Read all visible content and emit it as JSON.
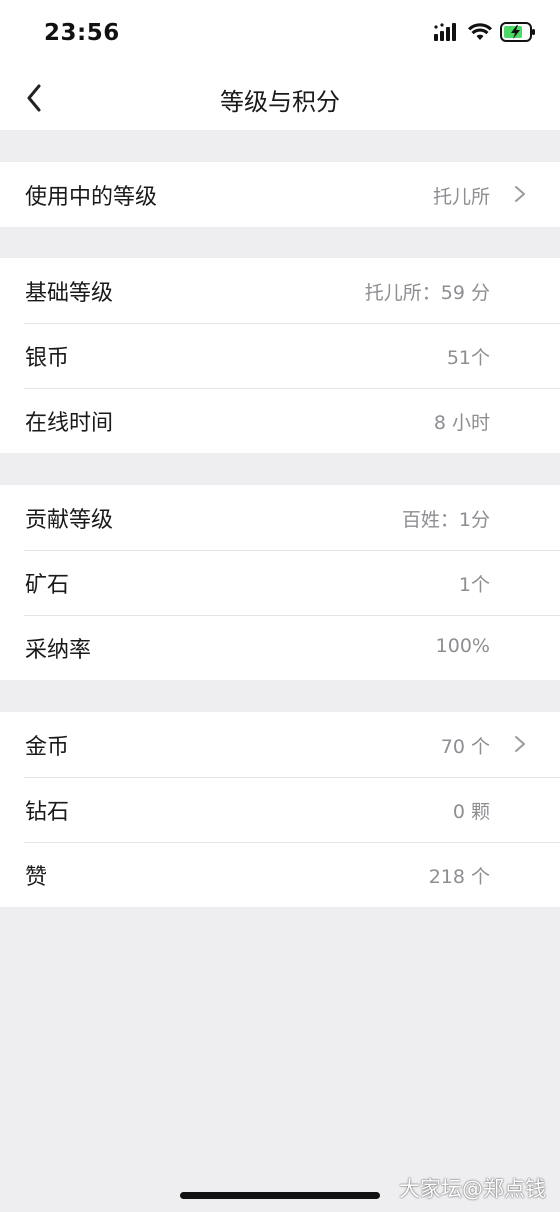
{
  "status_bar": {
    "time": "23:56"
  },
  "nav": {
    "title": "等级与积分"
  },
  "groups": [
    {
      "rows": [
        {
          "label": "使用中的等级",
          "value": "托儿所",
          "has_chevron": true
        }
      ]
    },
    {
      "rows": [
        {
          "label": "基础等级",
          "value": "托儿所：59 分",
          "has_chevron": false
        },
        {
          "label": "银币",
          "value": "51个",
          "has_chevron": false
        },
        {
          "label": "在线时间",
          "value": "8 小时",
          "has_chevron": false
        }
      ]
    },
    {
      "rows": [
        {
          "label": "贡献等级",
          "value": "百姓：1分",
          "has_chevron": false
        },
        {
          "label": "矿石",
          "value": "1个",
          "has_chevron": false
        },
        {
          "label": "采纳率",
          "value": "100%",
          "has_chevron": false
        }
      ]
    },
    {
      "rows": [
        {
          "label": "金币",
          "value": "70 个",
          "has_chevron": true
        },
        {
          "label": "钻石",
          "value": "0 颗",
          "has_chevron": false
        },
        {
          "label": "赞",
          "value": "218 个",
          "has_chevron": false
        }
      ]
    }
  ],
  "watermark": "大家坛@郑点钱",
  "colors": {
    "background": "#eeeef0",
    "card": "#ffffff",
    "label": "#1a1a1a",
    "value": "#8e8e93",
    "battery": "#4cd964"
  }
}
